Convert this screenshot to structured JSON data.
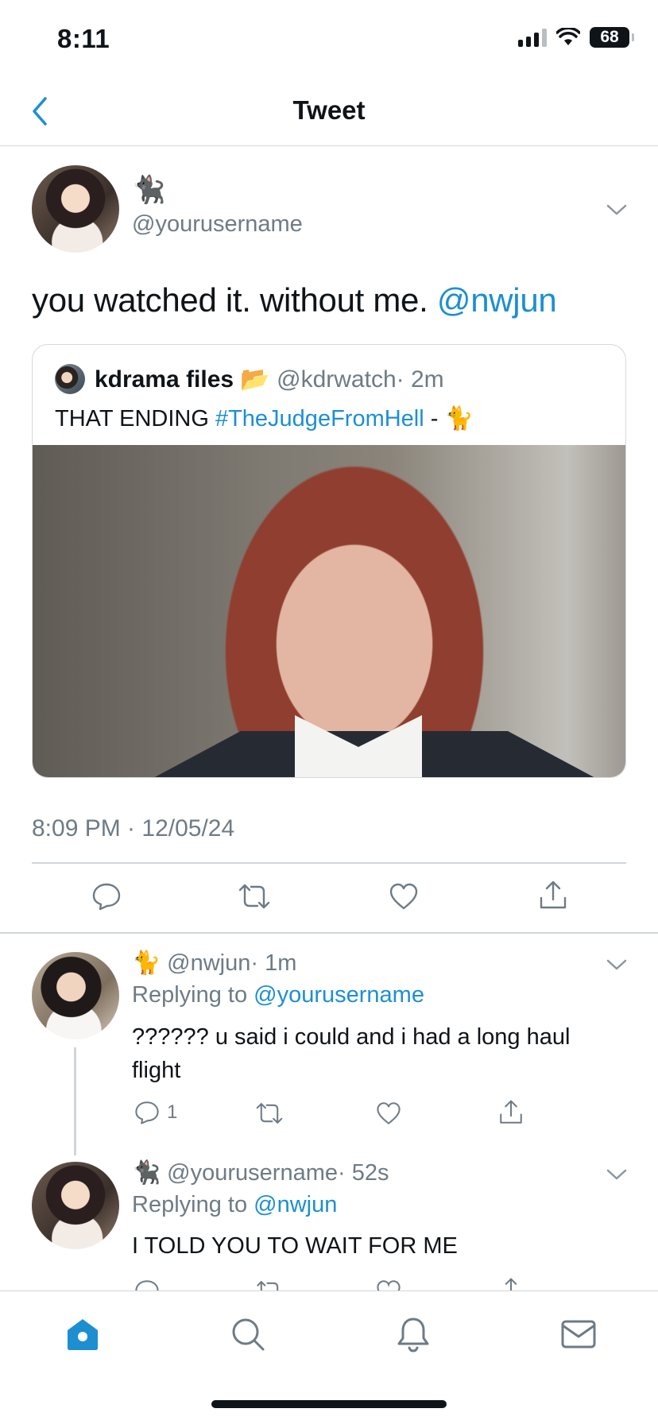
{
  "status_bar": {
    "time": "8:11",
    "battery": "68"
  },
  "header": {
    "title": "Tweet"
  },
  "tweet": {
    "display_emoji": "🐈‍⬛",
    "username": "@yourusername",
    "text": "you watched it. without me. ",
    "mention": "@nwjun",
    "timestamp": "8:09 PM · 12/05/24"
  },
  "quote": {
    "name": "kdrama files 📂",
    "handle": "@kdrwatch",
    "time": "· 2m",
    "text": "THAT ENDING ",
    "hashtag": "#TheJudgeFromHell",
    "text_suffix": " - 🐈"
  },
  "replies": [
    {
      "emoji": "🐈",
      "handle": "@nwjun",
      "time": "· 1m",
      "replying_prefix": "Replying to ",
      "replying_to": "@yourusername",
      "text": "?????? u said i could and i had a long haul flight",
      "reply_count": "1"
    },
    {
      "emoji": "🐈‍⬛",
      "handle": "@yourusername",
      "time": "· 52s",
      "replying_prefix": "Replying to ",
      "replying_to": "@nwjun",
      "text": "I TOLD YOU TO WAIT FOR ME"
    }
  ],
  "icons": {
    "back": "chevron-left-icon",
    "reply": "speech-bubble-icon",
    "retweet": "retweet-icon",
    "like": "heart-icon",
    "share": "share-icon",
    "home": "home-icon",
    "search": "search-icon",
    "notifications": "bell-icon",
    "messages": "envelope-icon"
  },
  "colors": {
    "accent": "#1d8fd1",
    "text": "#0f1419",
    "muted": "#6e7b86",
    "divider": "#cfd5da"
  }
}
